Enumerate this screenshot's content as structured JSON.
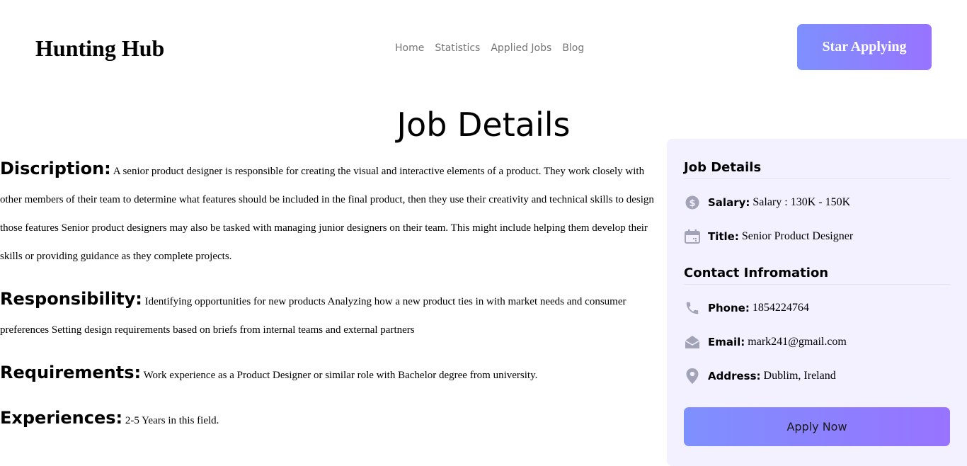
{
  "header": {
    "brand": "Hunting Hub",
    "nav": [
      "Home",
      "Statistics",
      "Applied Jobs",
      "Blog"
    ],
    "cta_label": "Star Applying"
  },
  "page_title": "Job Details",
  "details": {
    "description": {
      "heading": "Discription:",
      "text": "A senior product designer is responsible for creating the visual and interactive elements of a product. They work closely with other members of their team to determine what features should be included in the final product, then they use their creativity and technical skills to design those features Senior product designers may also be tasked with managing junior designers on their team. This might include helping them develop their skills or providing guidance as they complete projects."
    },
    "responsibility": {
      "heading": "Responsibility:",
      "text": "Identifying opportunities for new products Analyzing how a new product ties in with market needs and consumer preferences Setting design requirements based on briefs from internal teams and external partners"
    },
    "requirements": {
      "heading": "Requirements:",
      "text": "Work experience as a Product Designer or similar role with Bachelor degree from university."
    },
    "experiences": {
      "heading": "Experiences:",
      "text": "2-5 Years in this field."
    }
  },
  "sidebar": {
    "job_heading": "Job Details",
    "salary_label": "Salary:",
    "salary_value": "Salary : 130K - 150K",
    "title_label": "Title:",
    "title_value": "Senior Product Designer",
    "contact_heading": "Contact Infromation",
    "phone_label": "Phone:",
    "phone_value": "1854224764",
    "email_label": "Email:",
    "email_value": "mark241@gmail.com",
    "address_label": "Address:",
    "address_value": "Dublim, Ireland",
    "apply_label": "Apply Now"
  },
  "icons": [
    "dollar-icon",
    "calendar-icon",
    "phone-icon",
    "envelope-icon",
    "location-icon"
  ],
  "colors": {
    "accent_start": "#7e90fe",
    "accent_end": "#9873ff",
    "sidebar_bg": "#f3f1ff",
    "icon": "#a3a3b8"
  }
}
